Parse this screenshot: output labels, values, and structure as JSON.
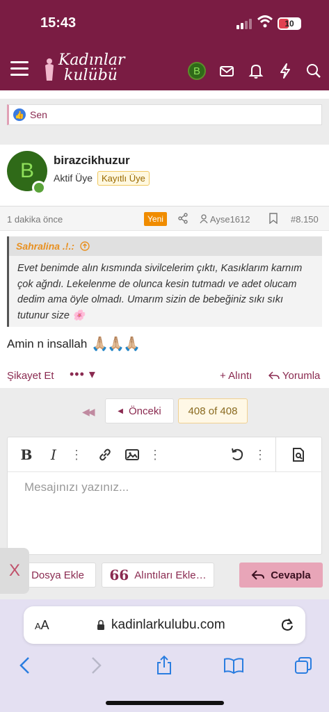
{
  "status": {
    "time": "15:43",
    "battery": "10"
  },
  "header": {
    "logo_line1": "Kadınlar",
    "logo_line2": "kulübü",
    "avatar_letter": "B"
  },
  "reactions": {
    "text": "Sen"
  },
  "post": {
    "avatar_letter": "B",
    "username": "birazcikhuzur",
    "role": "Aktif Üye",
    "badge": "Kayıtlı Üye",
    "time": "1 dakika önce",
    "new_badge": "Yeni",
    "quoted_user": "Ayse1612",
    "post_number": "#8.150",
    "quote": {
      "author": "Sahralina .!.:",
      "text": "Evet benimde alın kısmında sivilcelerim çıktı, Kasıklarım karnım çok ağndı. Lekelenme de olunca kesin tutmadı ve adet olucam dedim ama öyle olmadı. Umarım sizin de bebeğiniz sıkı sıkı tutunur size 🌸"
    },
    "body": "Amin n insallah",
    "body_emoji": "🙏🏼🙏🏼🙏🏼",
    "actions": {
      "report": "Şikayet Et",
      "more": "••• ▾",
      "quote": "+ Alıntı",
      "reply": "Yorumla"
    }
  },
  "pagination": {
    "prev": "Önceki",
    "current": "408 of 408"
  },
  "editor": {
    "placeholder": "Mesajınızı yazınız...",
    "attach_label": "Dosya Ekle",
    "insert_quotes_label": "Alıntıları Ekle…",
    "reply_label": "Cevapla",
    "close": "X"
  },
  "browser": {
    "aa": "AA",
    "url": "kadinlarkulubu.com"
  },
  "colors": {
    "brand": "#7a1c43",
    "accent": "#8a2a50",
    "reply_button": "#e8a5b8"
  }
}
